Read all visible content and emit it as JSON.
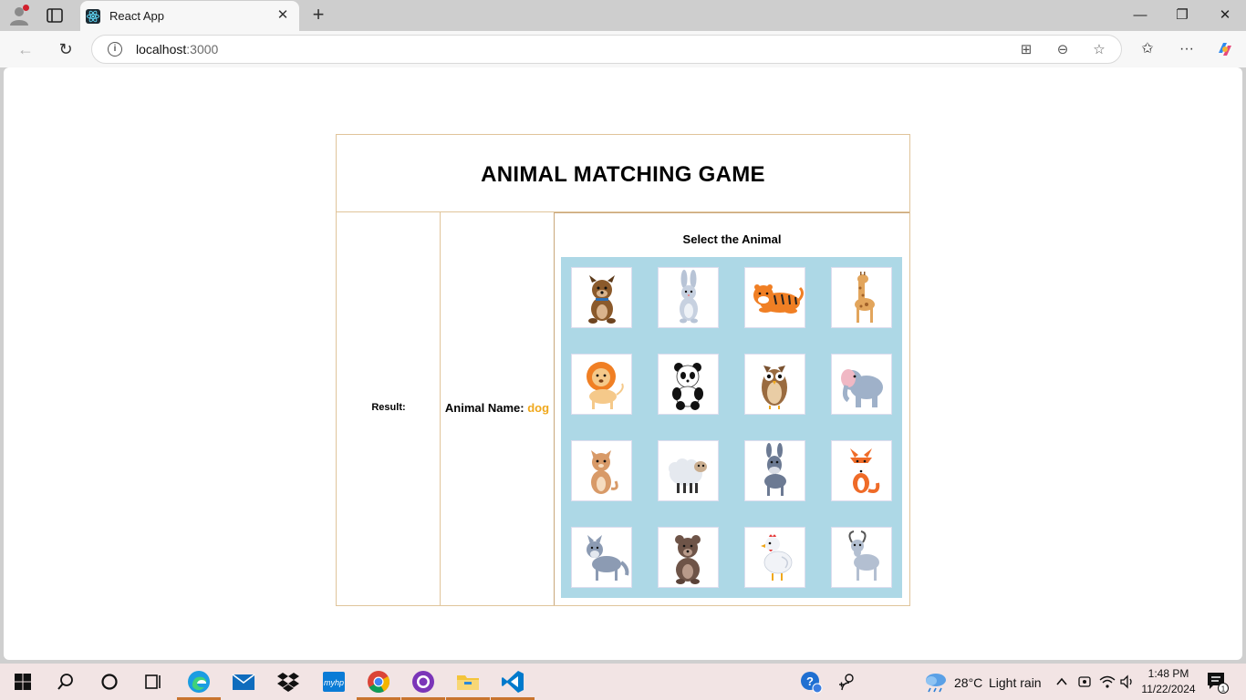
{
  "browser": {
    "tab_title": "React App",
    "url_host": "localhost",
    "url_port": ":3000",
    "icons": [
      "profile-icon",
      "tab-actions-icon",
      "close-tab-icon",
      "new-tab-icon",
      "minimize-icon",
      "restore-icon",
      "window-close-icon",
      "back-icon",
      "refresh-icon",
      "site-info-icon",
      "app-available-icon",
      "zoom-icon",
      "favorite-icon",
      "favorites-icon",
      "more-icon",
      "copilot-icon"
    ]
  },
  "game": {
    "title": "ANIMAL MATCHING GAME",
    "result_label": "Result:",
    "animal_name_label": "Animal Name: ",
    "animal_name_value": "dog",
    "select_title": "Select the Animal",
    "grid_bg": "#add8e6",
    "name_color": "#f0a81c",
    "animals": [
      "dog",
      "rabbit",
      "tiger",
      "giraffe",
      "lion",
      "panda",
      "owl",
      "elephant",
      "cat",
      "sheep",
      "donkey",
      "fox",
      "wolf",
      "bear",
      "chicken",
      "goat"
    ]
  },
  "taskbar": {
    "weather_temp": "28°C",
    "weather_desc": "Light rain",
    "time": "1:48 PM",
    "date": "11/22/2024",
    "notification_count": "1",
    "apps": [
      "start",
      "search",
      "cortana",
      "task-view",
      "edge",
      "mail",
      "dropbox",
      "myhp",
      "chrome",
      "github-desktop",
      "file-explorer",
      "vscode"
    ]
  }
}
